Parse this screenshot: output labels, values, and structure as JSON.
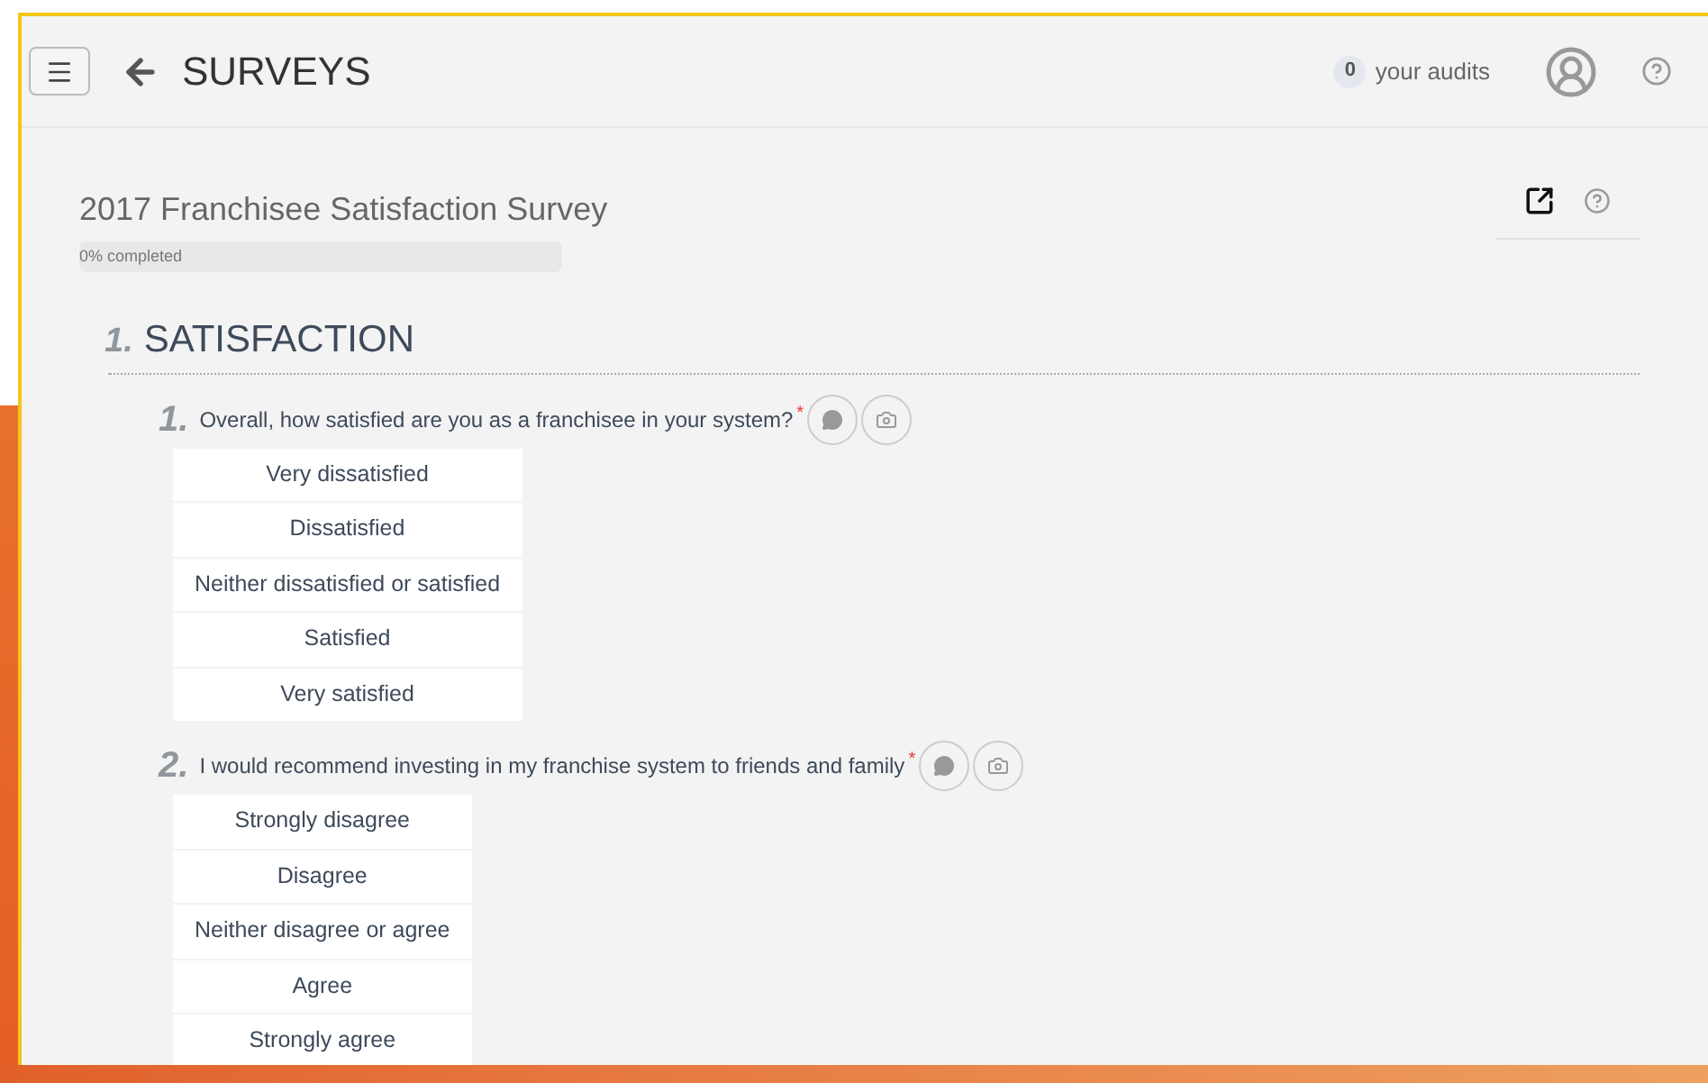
{
  "header": {
    "title": "SURVEYS",
    "audits_count": "0",
    "audits_label": "your audits"
  },
  "survey": {
    "title": "2017 Franchisee Satisfaction Survey",
    "progress": {
      "label": "0% completed",
      "level": 0
    }
  },
  "sections": [
    {
      "number": "1.",
      "title": "SATISFACTION",
      "questions": [
        {
          "number": "1.",
          "text": "Overall, how satisfied are you as a franchisee in your system?",
          "required_mark": "*",
          "options": [
            {
              "label": "Very dissatisfied",
              "selected": false
            },
            {
              "label": "Dissatisfied",
              "selected": false
            },
            {
              "label": "Neither dissatisfied or satisfied",
              "selected": false
            },
            {
              "label": "Satisfied",
              "selected": false
            },
            {
              "label": "Very satisfied",
              "selected": false
            }
          ]
        },
        {
          "number": "2.",
          "text": "I would recommend investing in my franchise system to friends and family",
          "required_mark": "*",
          "options": [
            {
              "label": "Strongly disagree",
              "selected": false
            },
            {
              "label": "Disagree",
              "selected": false
            },
            {
              "label": "Neither disagree or agree",
              "selected": false
            },
            {
              "label": "Agree",
              "selected": false
            },
            {
              "label": "Strongly agree",
              "selected": false
            }
          ]
        }
      ]
    }
  ]
}
